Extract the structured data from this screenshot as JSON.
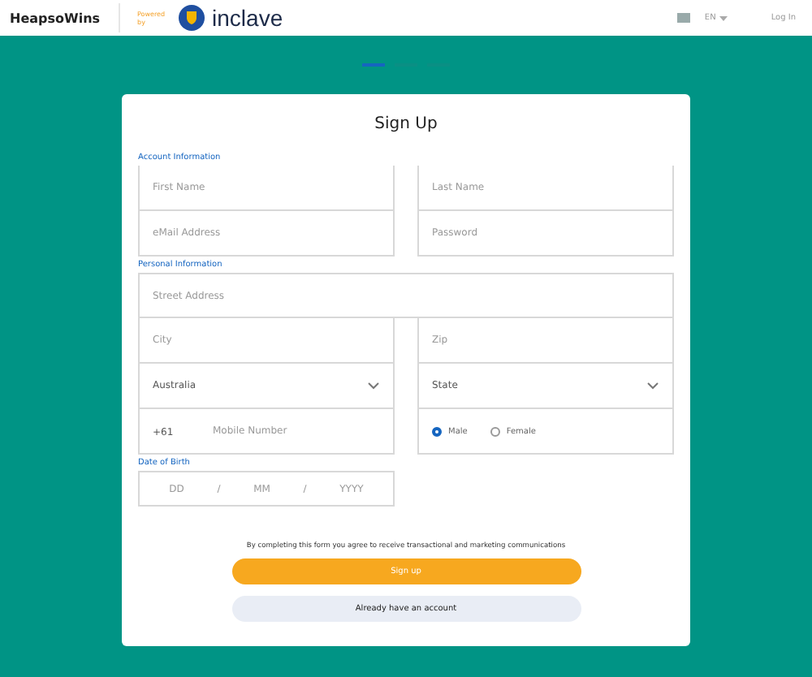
{
  "header": {
    "brand": "HeapsoWins",
    "powered_by": "Powered by",
    "partner": "inclave",
    "language": "EN",
    "login": "Log In"
  },
  "steps": [
    {
      "selected": true
    },
    {
      "selected": false
    },
    {
      "selected": false
    }
  ],
  "form": {
    "title": "Sign Up",
    "sections": [
      {
        "label": "Account Information",
        "rows": [
          [
            {
              "kind": "text",
              "placeholder": "First Name"
            },
            {
              "kind": "text",
              "placeholder": "Last Name"
            }
          ],
          [
            {
              "kind": "text",
              "placeholder": "eMail Address"
            },
            {
              "kind": "text",
              "placeholder": "Password"
            }
          ]
        ]
      },
      {
        "label": "Personal Information",
        "rows": [
          [
            {
              "kind": "text",
              "placeholder": "Street Address"
            }
          ],
          [
            {
              "kind": "text",
              "placeholder": "City"
            },
            {
              "kind": "text",
              "placeholder": "Zip"
            }
          ],
          [
            {
              "kind": "select",
              "value": "Australia"
            },
            {
              "kind": "select",
              "value": "State"
            }
          ],
          [
            {
              "kind": "phone",
              "prefix": "+61",
              "placeholder": "Mobile Number"
            },
            {
              "kind": "radio",
              "options": [
                {
                  "label": "Male",
                  "selected": true
                },
                {
                  "label": "Female",
                  "selected": false
                }
              ]
            }
          ]
        ]
      },
      {
        "label": "Date of Birth",
        "rows": [
          [
            {
              "kind": "date",
              "parts": [
                "DD",
                "/",
                "MM",
                "/",
                "YYYY"
              ]
            }
          ]
        ]
      }
    ],
    "consent": "By completing this form you agree to receive transactional and marketing communications",
    "submit": "Sign up",
    "secondary": "Already have an account"
  }
}
